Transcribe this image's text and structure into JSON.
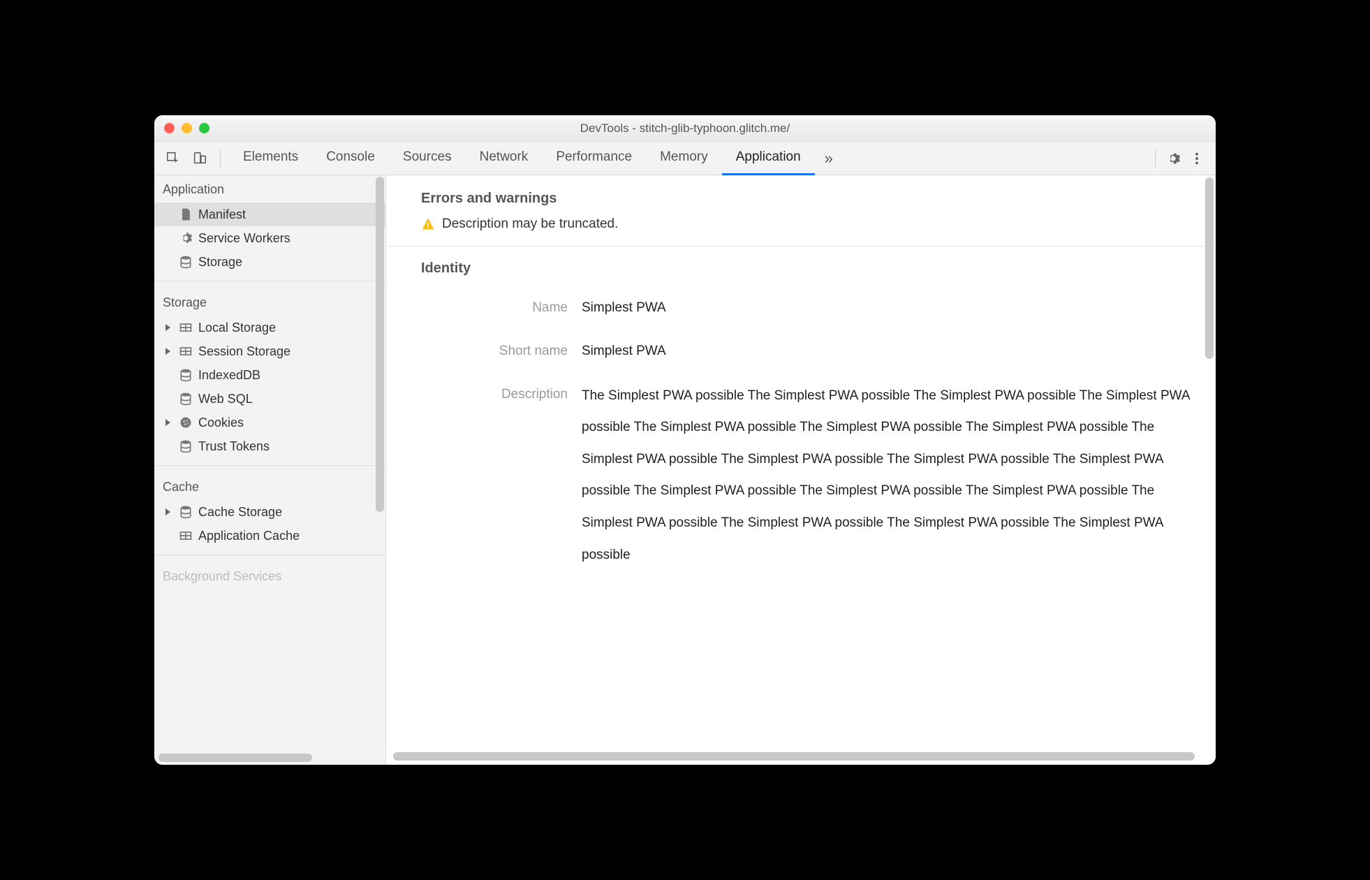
{
  "window": {
    "title": "DevTools - stitch-glib-typhoon.glitch.me/"
  },
  "toolbar": {
    "tabs": [
      {
        "label": "Elements",
        "active": false
      },
      {
        "label": "Console",
        "active": false
      },
      {
        "label": "Sources",
        "active": false
      },
      {
        "label": "Network",
        "active": false
      },
      {
        "label": "Performance",
        "active": false
      },
      {
        "label": "Memory",
        "active": false
      },
      {
        "label": "Application",
        "active": true
      }
    ],
    "overflow": "»"
  },
  "sidebar": {
    "sections": [
      {
        "title": "Application",
        "items": [
          {
            "icon": "page",
            "label": "Manifest",
            "selected": true,
            "expandable": false
          },
          {
            "icon": "gear",
            "label": "Service Workers",
            "selected": false,
            "expandable": false
          },
          {
            "icon": "db",
            "label": "Storage",
            "selected": false,
            "expandable": false
          }
        ]
      },
      {
        "title": "Storage",
        "items": [
          {
            "icon": "grid",
            "label": "Local Storage",
            "expandable": true
          },
          {
            "icon": "grid",
            "label": "Session Storage",
            "expandable": true
          },
          {
            "icon": "db",
            "label": "IndexedDB",
            "expandable": false
          },
          {
            "icon": "db",
            "label": "Web SQL",
            "expandable": false
          },
          {
            "icon": "cookie",
            "label": "Cookies",
            "expandable": true
          },
          {
            "icon": "db",
            "label": "Trust Tokens",
            "expandable": false
          }
        ]
      },
      {
        "title": "Cache",
        "items": [
          {
            "icon": "db",
            "label": "Cache Storage",
            "expandable": true
          },
          {
            "icon": "grid",
            "label": "Application Cache",
            "expandable": false
          }
        ]
      },
      {
        "title": "Background Services",
        "items": []
      }
    ]
  },
  "main": {
    "errors_heading": "Errors and warnings",
    "warning_text": "Description may be truncated.",
    "identity_heading": "Identity",
    "identity": {
      "name_label": "Name",
      "name_value": "Simplest PWA",
      "shortname_label": "Short name",
      "shortname_value": "Simplest PWA",
      "description_label": "Description",
      "description_value": "The Simplest PWA possible The Simplest PWA possible The Simplest PWA possible The Simplest PWA possible The Simplest PWA possible The Simplest PWA possible The Simplest PWA possible The Simplest PWA possible The Simplest PWA possible The Simplest PWA possible The Simplest PWA possible The Simplest PWA possible The Simplest PWA possible The Simplest PWA possible The Simplest PWA possible The Simplest PWA possible The Simplest PWA possible The Simplest PWA possible"
    }
  },
  "colors": {
    "accent": "#1a73e8",
    "warning": "#fbbc04"
  }
}
